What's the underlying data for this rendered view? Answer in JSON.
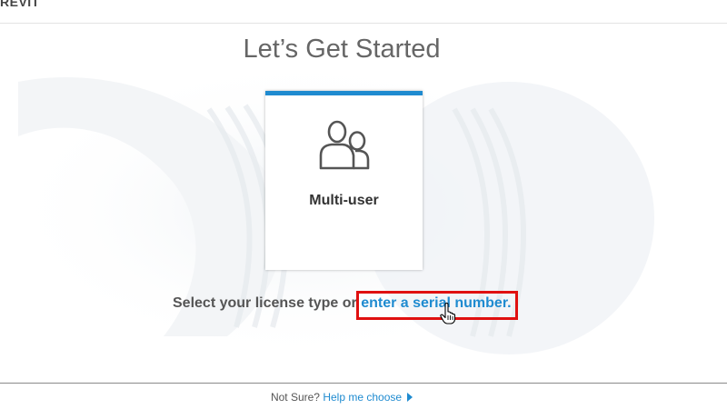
{
  "header": {
    "brand": "REVIT"
  },
  "page": {
    "title": "Let’s Get Started"
  },
  "license_card": {
    "label": "Multi-user",
    "icon": "users-icon",
    "accent_color": "#1f8bd0"
  },
  "license_prompt": {
    "text": "Select your license type or",
    "link_text": "enter a serial number."
  },
  "footer": {
    "not_sure": "Not Sure?",
    "help_link": "Help me choose",
    "help_icon": "play-icon"
  },
  "colors": {
    "link": "#1f8bd0",
    "highlight": "#e01010"
  }
}
